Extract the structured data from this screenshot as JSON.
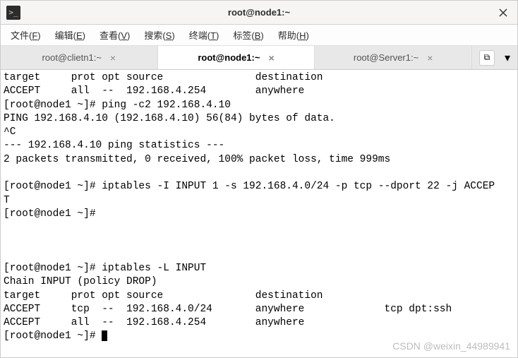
{
  "window": {
    "title": "root@node1:~",
    "icon_glyph": ">_"
  },
  "menu": {
    "items": [
      {
        "pre": "文件(",
        "key": "F",
        "post": ")"
      },
      {
        "pre": "编辑(",
        "key": "E",
        "post": ")"
      },
      {
        "pre": "查看(",
        "key": "V",
        "post": ")"
      },
      {
        "pre": "搜索(",
        "key": "S",
        "post": ")"
      },
      {
        "pre": "终端(",
        "key": "T",
        "post": ")"
      },
      {
        "pre": "标签(",
        "key": "B",
        "post": ")"
      },
      {
        "pre": "帮助(",
        "key": "H",
        "post": ")"
      }
    ]
  },
  "tabs": {
    "items": [
      {
        "label": "root@clietn1:~",
        "active": false
      },
      {
        "label": "root@node1:~",
        "active": true
      },
      {
        "label": "root@Server1:~",
        "active": false
      }
    ],
    "newtab_glyph": "⧉",
    "dropdown_glyph": "▾"
  },
  "terminal": {
    "lines": [
      "target     prot opt source               destination",
      "ACCEPT     all  --  192.168.4.254        anywhere",
      "[root@node1 ~]# ping -c2 192.168.4.10",
      "PING 192.168.4.10 (192.168.4.10) 56(84) bytes of data.",
      "^C",
      "--- 192.168.4.10 ping statistics ---",
      "2 packets transmitted, 0 received, 100% packet loss, time 999ms",
      "",
      "[root@node1 ~]# iptables -I INPUT 1 -s 192.168.4.0/24 -p tcp --dport 22 -j ACCEP",
      "T",
      "[root@node1 ~]#",
      "",
      "",
      "",
      "[root@node1 ~]# iptables -L INPUT",
      "Chain INPUT (policy DROP)",
      "target     prot opt source               destination",
      "ACCEPT     tcp  --  192.168.4.0/24       anywhere             tcp dpt:ssh",
      "ACCEPT     all  --  192.168.4.254        anywhere"
    ],
    "prompt_last": "[root@node1 ~]# "
  },
  "watermark": "CSDN @weixin_44989941"
}
